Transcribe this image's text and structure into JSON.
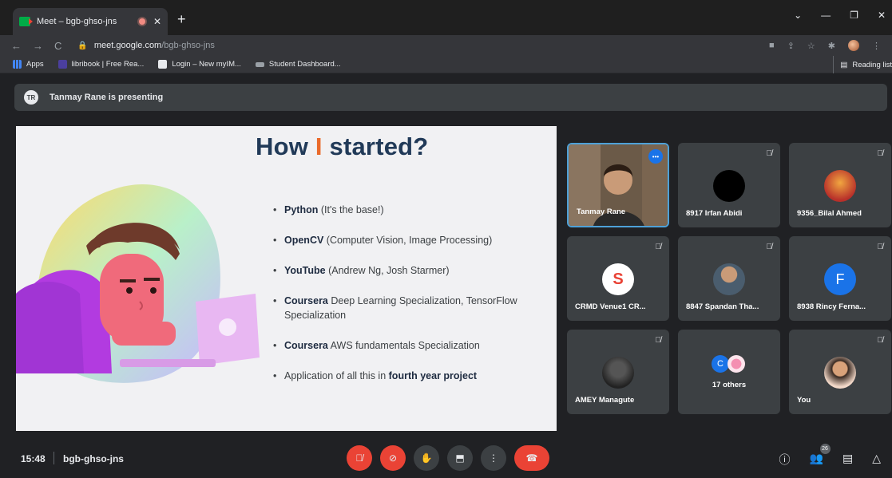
{
  "browser": {
    "tab_title": "Meet – bgb-ghso-jns",
    "tab_close": "✕",
    "new_tab": "+",
    "window_controls": [
      "⌄",
      "—",
      "❐",
      "✕"
    ],
    "nav": {
      "back": "←",
      "forward": "→",
      "reload": "C"
    },
    "url_host": "meet.google.com",
    "url_path": "/bgb-ghso-jns",
    "bookmarks": [
      {
        "label": "Apps",
        "color": "#fbbc04"
      },
      {
        "label": "libribook | Free Rea...",
        "color": "#4b3f9e"
      },
      {
        "label": "Login – New myIM...",
        "color": "#e8eaed"
      },
      {
        "label": "Student Dashboard...",
        "color": "#9aa0a6"
      }
    ],
    "reading_list": "Reading list"
  },
  "meet": {
    "presenting_text": "Tanmay Rane is presenting",
    "presenter_initials": "TR",
    "slide": {
      "title_pre": "How",
      "title_accent": "I",
      "title_post": "started?",
      "accent_color": "#ea6a2a",
      "bullets": [
        {
          "bold": "Python",
          "text": " (It's the base!)"
        },
        {
          "bold": "OpenCV",
          "text": " (Computer Vision, Image Processing)"
        },
        {
          "bold": "YouTube",
          "text": " (Andrew Ng, Josh Starmer)"
        },
        {
          "bold": "Coursera",
          "text": " Deep Learning Specialization, TensorFlow Specialization"
        },
        {
          "bold": "Coursera",
          "text": " AWS fundamentals Specialization"
        },
        {
          "pre": "Application of all this in ",
          "bold": "fourth year project"
        }
      ]
    },
    "participants": [
      {
        "name": "Tanmay Rane",
        "speaking": true
      },
      {
        "name": "8917 Irfan Abidi",
        "muted": true
      },
      {
        "name": "9356_Bilal Ahmed",
        "muted": true
      },
      {
        "name": "CRMD Venue1 CR...",
        "muted": true
      },
      {
        "name": "8847 Spandan Tha...",
        "muted": true
      },
      {
        "name": "8938 Rincy Ferna...",
        "muted": true,
        "initial": "F",
        "avatar_color": "#1a73e8"
      },
      {
        "name": "AMEY Managute",
        "muted": true
      },
      {
        "name": "17 others",
        "initial": "C",
        "avatar_color": "#1a73e8"
      },
      {
        "name": "You",
        "muted": true
      }
    ],
    "bottom": {
      "time": "15:48",
      "meeting_code": "bgb-ghso-jns",
      "people_count": "26"
    }
  }
}
